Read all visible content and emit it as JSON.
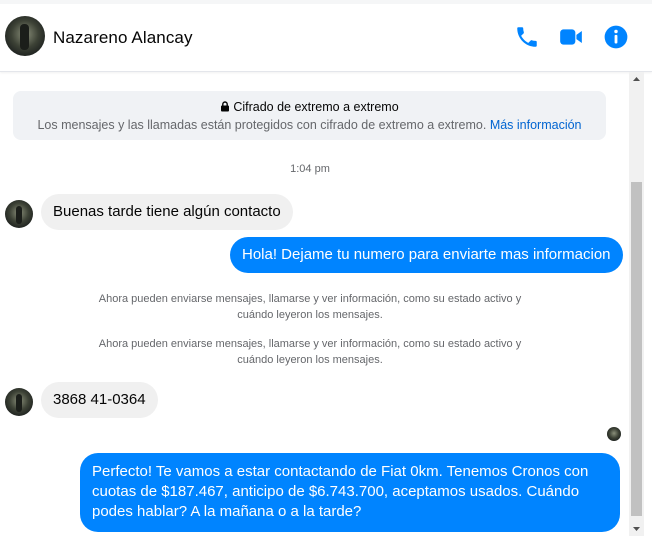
{
  "header": {
    "contact_name": "Nazareno Alancay",
    "icons": [
      "phone-icon",
      "video-icon",
      "info-icon"
    ],
    "accent_color": "#0084ff"
  },
  "encryption_notice": {
    "title": "Cifrado de extremo a extremo",
    "text": "Los mensajes y las llamadas están protegidos con cifrado de extremo a extremo.",
    "link": "Más información"
  },
  "timestamp": "1:04 pm",
  "messages": [
    {
      "from": "contact",
      "text": "Buenas tarde tiene algún contacto"
    },
    {
      "from": "me",
      "text": "Hola! Dejame tu numero para enviarte mas informacion"
    },
    {
      "from": "system",
      "text": "Ahora pueden enviarse mensajes, llamarse y ver información, como su estado activo y cuándo leyeron los mensajes."
    },
    {
      "from": "system",
      "text": "Ahora pueden enviarse mensajes, llamarse y ver información, como su estado activo y cuándo leyeron los mensajes."
    },
    {
      "from": "contact",
      "text": "3868 41-0364"
    },
    {
      "from": "me",
      "text": "Perfecto! Te vamos a estar contactando de Fiat 0km. Tenemos Cronos con cuotas de $187.467, anticipo de $6.743.700, aceptamos usados. Cuándo podes hablar? A la mañana o a la tarde?"
    }
  ]
}
